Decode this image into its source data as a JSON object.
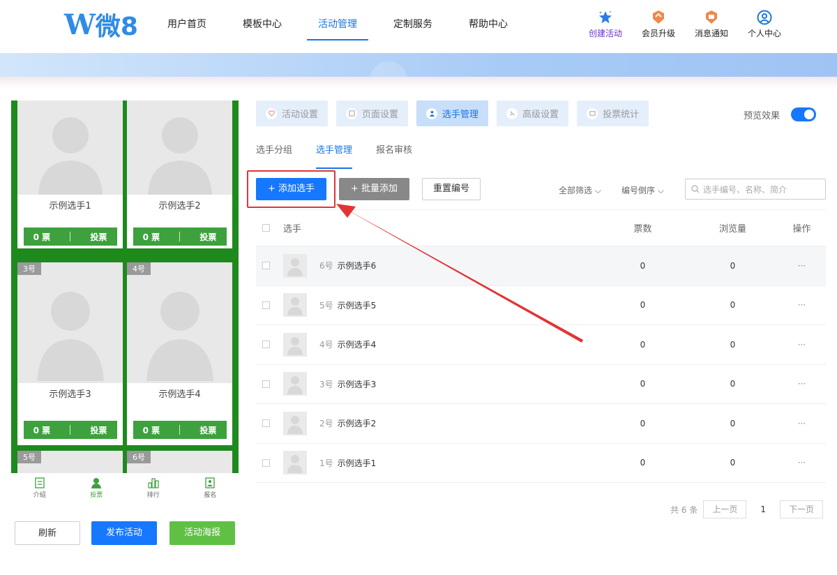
{
  "brand": {
    "logo_w": "W",
    "logo_text": "微8"
  },
  "nav": [
    {
      "label": "用户首页"
    },
    {
      "label": "模板中心"
    },
    {
      "label": "活动管理"
    },
    {
      "label": "定制服务"
    },
    {
      "label": "帮助中心"
    }
  ],
  "toolbar": {
    "create": "创建活动",
    "upgrade": "会员升级",
    "notice": "消息通知",
    "profile": "个人中心"
  },
  "preview": {
    "cards": [
      {
        "name": "示例选手1",
        "votes": "0 票",
        "vote_btn": "投票",
        "tag": ""
      },
      {
        "name": "示例选手2",
        "votes": "0 票",
        "vote_btn": "投票",
        "tag": ""
      },
      {
        "name": "示例选手3",
        "votes": "0 票",
        "vote_btn": "投票",
        "tag": "3号"
      },
      {
        "name": "示例选手4",
        "votes": "0 票",
        "vote_btn": "投票",
        "tag": "4号"
      }
    ],
    "partial_tags": [
      "5号",
      "6号"
    ],
    "tabs": [
      "介绍",
      "投票",
      "排行",
      "报名"
    ]
  },
  "actions": {
    "refresh": "刷新",
    "publish": "发布活动",
    "poster": "活动海报"
  },
  "steps": [
    "活动设置",
    "页面设置",
    "选手管理",
    "高级设置",
    "投票统计"
  ],
  "preview_toggle": "预览效果",
  "subtabs": [
    "选手分组",
    "选手管理",
    "报名审核"
  ],
  "buttons": {
    "add": "+ 添加选手",
    "batch": "+ 批量添加",
    "reset": "重置编号"
  },
  "filters": {
    "all": "全部筛选",
    "order": "编号倒序"
  },
  "search": {
    "placeholder": "选手编号、名称、简介"
  },
  "table": {
    "headers": {
      "player": "选手",
      "votes": "票数",
      "views": "浏览量",
      "op": "操作"
    },
    "rows": [
      {
        "num": "6号",
        "name": "示例选手6",
        "votes": "0",
        "views": "0",
        "op": "···"
      },
      {
        "num": "5号",
        "name": "示例选手5",
        "votes": "0",
        "views": "0",
        "op": "···"
      },
      {
        "num": "4号",
        "name": "示例选手4",
        "votes": "0",
        "views": "0",
        "op": "···"
      },
      {
        "num": "3号",
        "name": "示例选手3",
        "votes": "0",
        "views": "0",
        "op": "···"
      },
      {
        "num": "2号",
        "name": "示例选手2",
        "votes": "0",
        "views": "0",
        "op": "···"
      },
      {
        "num": "1号",
        "name": "示例选手1",
        "votes": "0",
        "views": "0",
        "op": "···"
      }
    ]
  },
  "pagination": {
    "total": "共 6 条",
    "prev": "上一页",
    "current": "1",
    "next": "下一页"
  },
  "colors": {
    "primary": "#1677ff",
    "green": "#3da13d",
    "annotation": "#e23434"
  }
}
